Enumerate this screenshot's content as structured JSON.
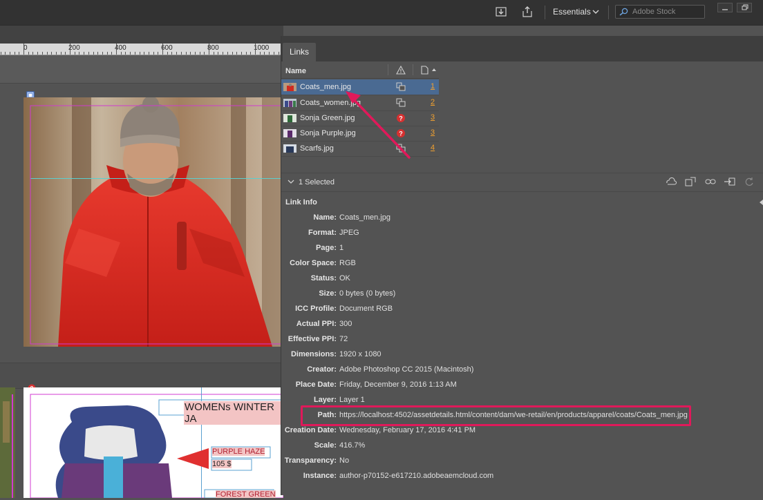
{
  "topbar": {
    "workspace_label": "Essentials",
    "search_placeholder": "Adobe Stock"
  },
  "ruler": {
    "labels": [
      "0",
      "200",
      "400",
      "600",
      "800",
      "1000"
    ]
  },
  "page2": {
    "heading": "WOMENs WINTER JA",
    "label1": "PURPLE HAZE",
    "price1": "105 $",
    "label2": "FOREST GREEN"
  },
  "links_panel": {
    "tab_label": "Links",
    "column_name": "Name",
    "items": [
      {
        "name": "Coats_men.jpg",
        "page": "1",
        "status": "linked",
        "selected": true
      },
      {
        "name": "Coats_women.jpg",
        "page": "2",
        "status": "linked",
        "selected": false
      },
      {
        "name": "Sonja Green.jpg",
        "page": "3",
        "status": "missing",
        "selected": false
      },
      {
        "name": "Sonja Purple.jpg",
        "page": "3",
        "status": "missing",
        "selected": false
      },
      {
        "name": "Scarfs.jpg",
        "page": "4",
        "status": "linked",
        "selected": false
      }
    ],
    "selection_text": "1 Selected",
    "info_header": "Link Info",
    "info": [
      {
        "label": "Name:",
        "value": "Coats_men.jpg"
      },
      {
        "label": "Format:",
        "value": "JPEG"
      },
      {
        "label": "Page:",
        "value": "1"
      },
      {
        "label": "Color Space:",
        "value": "RGB"
      },
      {
        "label": "Status:",
        "value": "OK"
      },
      {
        "label": "Size:",
        "value": "0 bytes (0 bytes)"
      },
      {
        "label": "ICC Profile:",
        "value": "Document RGB"
      },
      {
        "label": "Actual PPI:",
        "value": "300"
      },
      {
        "label": "Effective PPI:",
        "value": "72"
      },
      {
        "label": "Dimensions:",
        "value": "1920 x 1080"
      },
      {
        "label": "Creator:",
        "value": "Adobe Photoshop CC 2015 (Macintosh)"
      },
      {
        "label": "Place Date:",
        "value": "Friday, December 9, 2016 1:13 AM"
      },
      {
        "label": "Layer:",
        "value": "Layer 1"
      },
      {
        "label": "Path:",
        "value": "https://localhost:4502/assetdetails.html/content/dam/we-retail/en/products/apparel/coats/Coats_men.jpg"
      },
      {
        "label": "Creation Date:",
        "value": "Wednesday, February 17, 2016 4:41 PM"
      },
      {
        "label": "Scale:",
        "value": "416.7%"
      },
      {
        "label": "Transparency:",
        "value": "No"
      },
      {
        "label": "Instance:",
        "value": "author-p70152-e617210.adobeaemcloud.com"
      }
    ]
  },
  "colors": {
    "accent_highlight": "#e0195a",
    "selection_row": "#4a6a92",
    "page_link": "#f0a030",
    "missing_badge": "#d63030"
  }
}
